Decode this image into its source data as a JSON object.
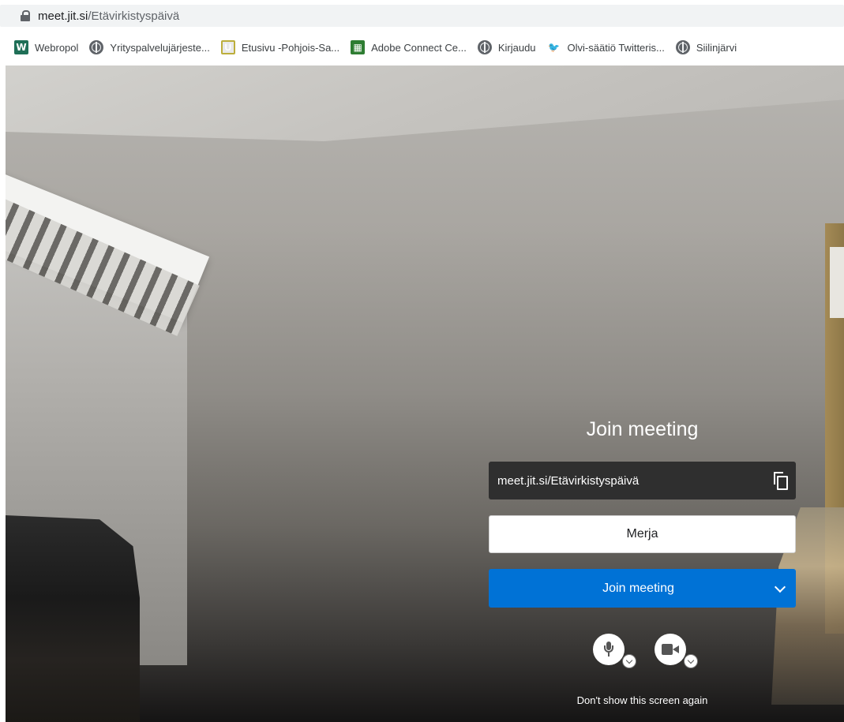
{
  "browser": {
    "url_host": "meet.jit.si",
    "url_path": "/Etävirkistyspäivä",
    "bookmarks": [
      {
        "label": "Webropol",
        "icon": "webropol-icon"
      },
      {
        "label": "Yrityspalvelujärjeste...",
        "icon": "globe-icon"
      },
      {
        "label": "Etusivu -Pohjois-Sa...",
        "icon": "etusivu-icon"
      },
      {
        "label": "Adobe Connect Ce...",
        "icon": "adobe-connect-icon"
      },
      {
        "label": "Kirjaudu",
        "icon": "globe-icon"
      },
      {
        "label": "Olvi-säätiö Twitteris...",
        "icon": "twitter-icon"
      },
      {
        "label": "Siilinjärvi",
        "icon": "globe-icon"
      }
    ]
  },
  "join_panel": {
    "title": "Join meeting",
    "meeting_url": "meet.jit.si/Etävirkistyspäivä",
    "name_value": "Merja",
    "join_button_label": "Join meeting",
    "dont_show_label": "Don't show this screen again"
  },
  "colors": {
    "join_button": "#0072d6",
    "url_field": "#2f2f2f"
  }
}
